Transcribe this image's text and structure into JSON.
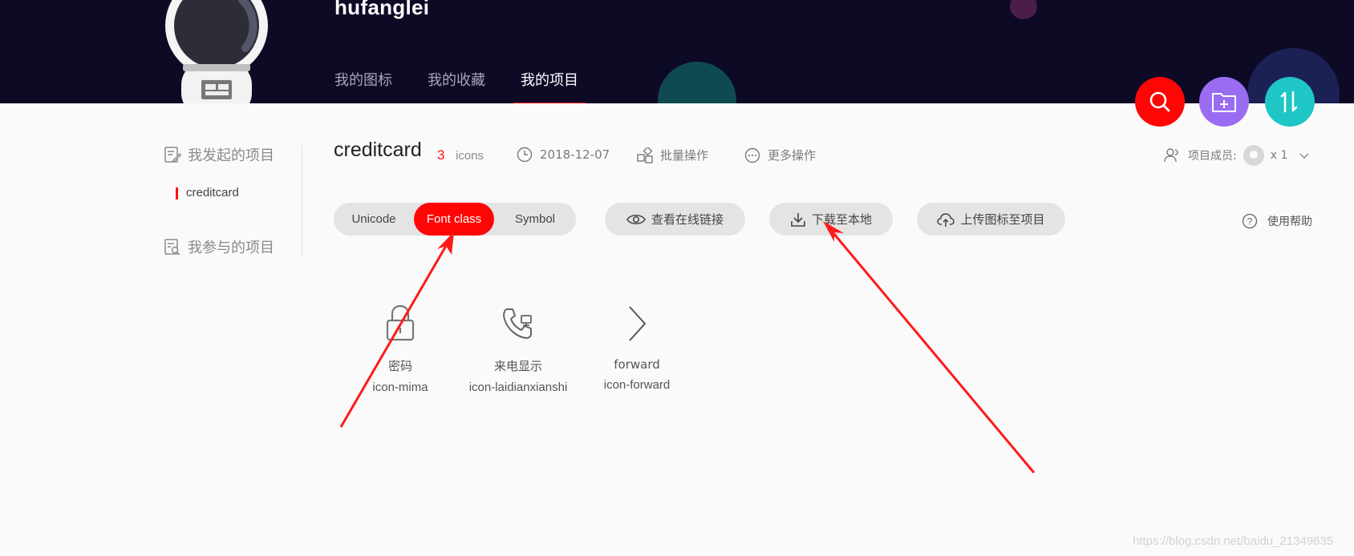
{
  "header": {
    "username": "hufanglei",
    "nav": [
      {
        "label": "我的图标",
        "active": false
      },
      {
        "label": "我的收藏",
        "active": false
      },
      {
        "label": "我的项目",
        "active": true
      }
    ]
  },
  "fab": {
    "icons": [
      "search-icon",
      "folder-add-icon",
      "sort-icon"
    ],
    "colors": {
      "search": "#ff0606",
      "add": "#9a6cf2",
      "sort": "#1ec6c6"
    }
  },
  "sidebar": {
    "started_label": "我发起的项目",
    "projects": [
      {
        "label": "creditcard",
        "active": true
      }
    ],
    "joined_label": "我参与的项目"
  },
  "project": {
    "name": "creditcard",
    "icon_count": "3",
    "icon_unit": "icons",
    "date": "2018-12-07",
    "batch_label": "批量操作",
    "more_label": "更多操作",
    "members_label": "项目成员:",
    "members_count": "x 1"
  },
  "toolbar": {
    "formats": [
      {
        "label": "Unicode",
        "active": false
      },
      {
        "label": "Font class",
        "active": true
      },
      {
        "label": "Symbol",
        "active": false
      }
    ],
    "view_link_label": "查看在线链接",
    "download_label": "下载至本地",
    "upload_label": "上传图标至项目",
    "help_label": "使用帮助"
  },
  "icons": [
    {
      "name": "密码",
      "code": "icon-mima",
      "glyph": "lock-icon"
    },
    {
      "name": "来电显示",
      "code": "icon-laidianxianshi",
      "glyph": "phone-display-icon"
    },
    {
      "name": "forward",
      "code": "icon-forward",
      "glyph": "chevron-right-icon"
    }
  ],
  "watermark": "https://blog.csdn.net/baidu_21349635",
  "colors": {
    "header_bg": "#0d0a26",
    "accent": "#ff0606",
    "pill_bg": "#e4e4e4"
  }
}
